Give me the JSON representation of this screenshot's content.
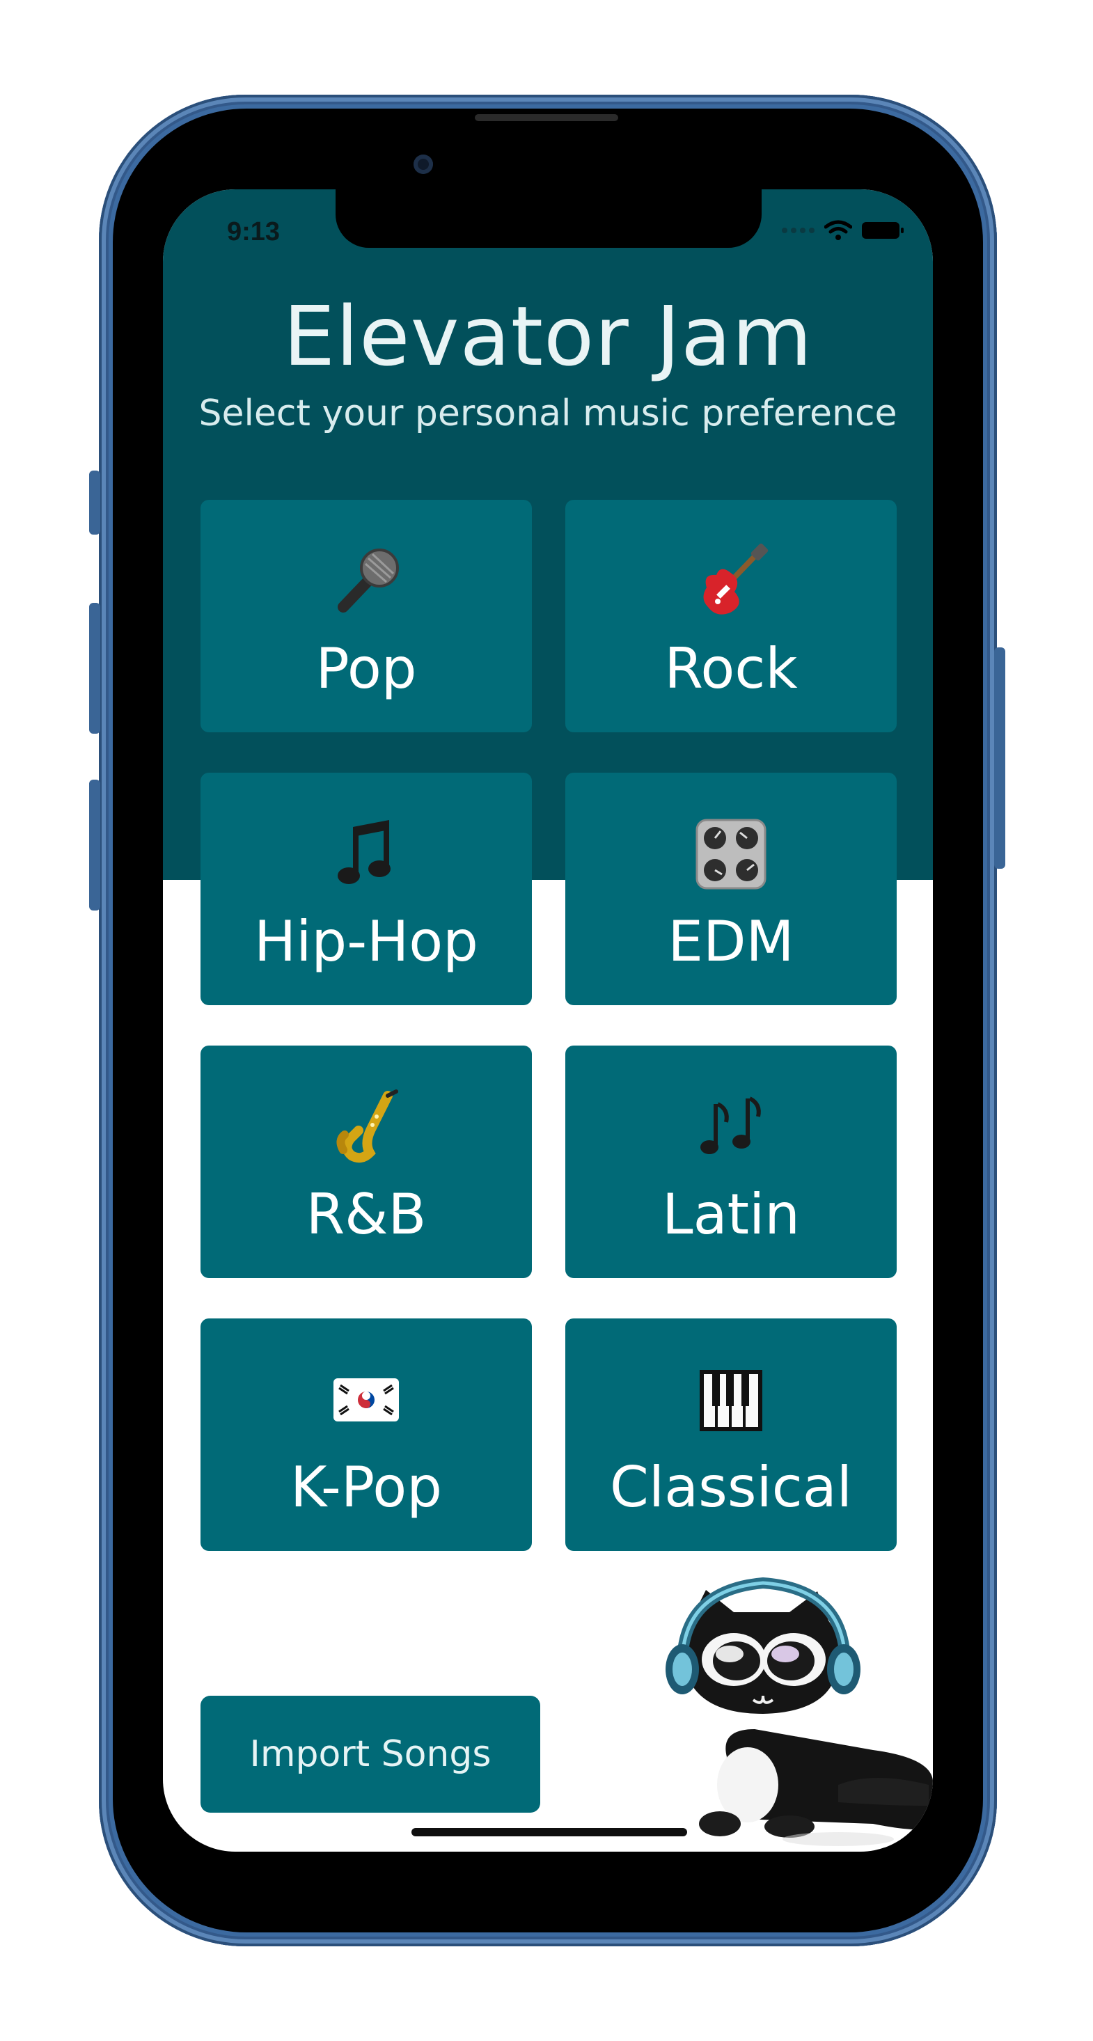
{
  "status_bar": {
    "time": "9:13"
  },
  "header": {
    "title": "Elevator Jam",
    "subtitle": "Select your personal music preference"
  },
  "genres": [
    {
      "label": "Pop",
      "icon": "microphone-icon"
    },
    {
      "label": "Rock",
      "icon": "electric-guitar-icon"
    },
    {
      "label": "Hip-Hop",
      "icon": "music-note-icon"
    },
    {
      "label": "EDM",
      "icon": "control-knobs-icon"
    },
    {
      "label": "R&B",
      "icon": "saxophone-icon"
    },
    {
      "label": "Latin",
      "icon": "musical-notes-icon"
    },
    {
      "label": "K-Pop",
      "icon": "korea-flag-icon"
    },
    {
      "label": "Classical",
      "icon": "piano-keys-icon"
    }
  ],
  "import_button": {
    "label": "Import Songs"
  },
  "colors": {
    "header_background": "#02505b",
    "tile_background": "#016a77",
    "frame": "#3c6aa0"
  }
}
